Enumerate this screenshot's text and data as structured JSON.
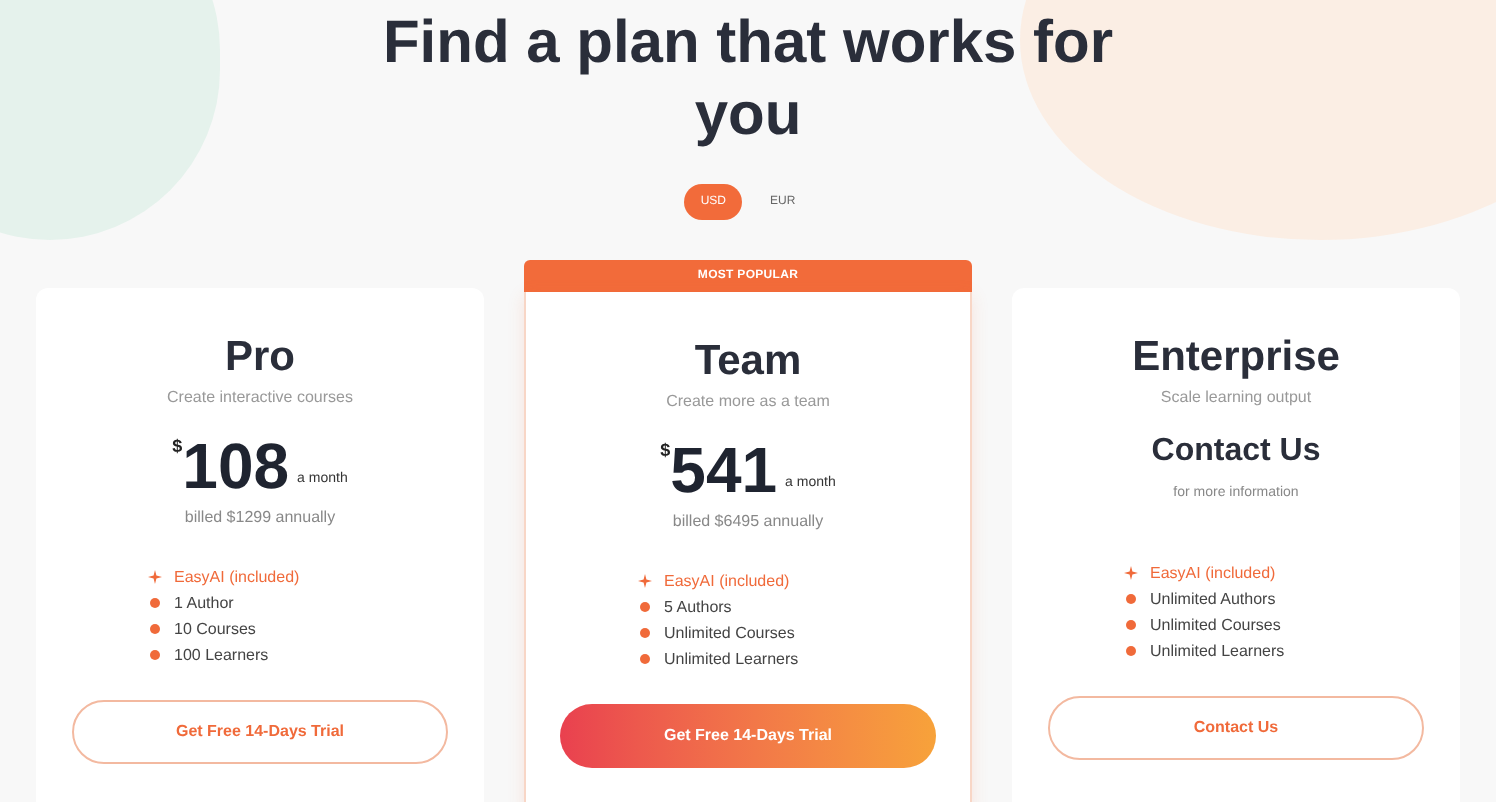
{
  "heading": "Find a plan that works for you",
  "currencies": [
    {
      "label": "USD",
      "selected": true
    },
    {
      "label": "EUR",
      "selected": false
    }
  ],
  "plans": [
    {
      "name": "Pro",
      "tagline": "Create interactive courses",
      "price": {
        "kind": "amount",
        "symbol": "$",
        "amount": "108",
        "period": "a month",
        "note": "billed $1299 annually"
      },
      "features": [
        {
          "kind": "ai",
          "text": "EasyAI (included)"
        },
        {
          "kind": "bullet",
          "text": "1 Author"
        },
        {
          "kind": "bullet",
          "text": "10 Courses"
        },
        {
          "kind": "bullet",
          "text": "100 Learners"
        }
      ],
      "button": {
        "label": "Get Free 14-Days Trial",
        "kind": "outline"
      }
    },
    {
      "name": "Team",
      "tagline": "Create more as a team",
      "badge": "MOST POPULAR",
      "price": {
        "kind": "amount",
        "symbol": "$",
        "amount": "541",
        "period": "a month",
        "note": "billed $6495 annually"
      },
      "features": [
        {
          "kind": "ai",
          "text": "EasyAI (included)"
        },
        {
          "kind": "bullet",
          "text": "5 Authors"
        },
        {
          "kind": "bullet",
          "text": "Unlimited Courses"
        },
        {
          "kind": "bullet",
          "text": "Unlimited Learners"
        }
      ],
      "button": {
        "label": "Get Free 14-Days Trial",
        "kind": "filled"
      }
    },
    {
      "name": "Enterprise",
      "tagline": "Scale learning output",
      "price": {
        "kind": "contact",
        "title": "Contact Us",
        "note": "for more information"
      },
      "features": [
        {
          "kind": "ai",
          "text": "EasyAI (included)"
        },
        {
          "kind": "bullet",
          "text": "Unlimited Authors"
        },
        {
          "kind": "bullet",
          "text": "Unlimited Courses"
        },
        {
          "kind": "bullet",
          "text": "Unlimited Learners"
        }
      ],
      "button": {
        "label": "Contact Us",
        "kind": "outline"
      }
    }
  ]
}
